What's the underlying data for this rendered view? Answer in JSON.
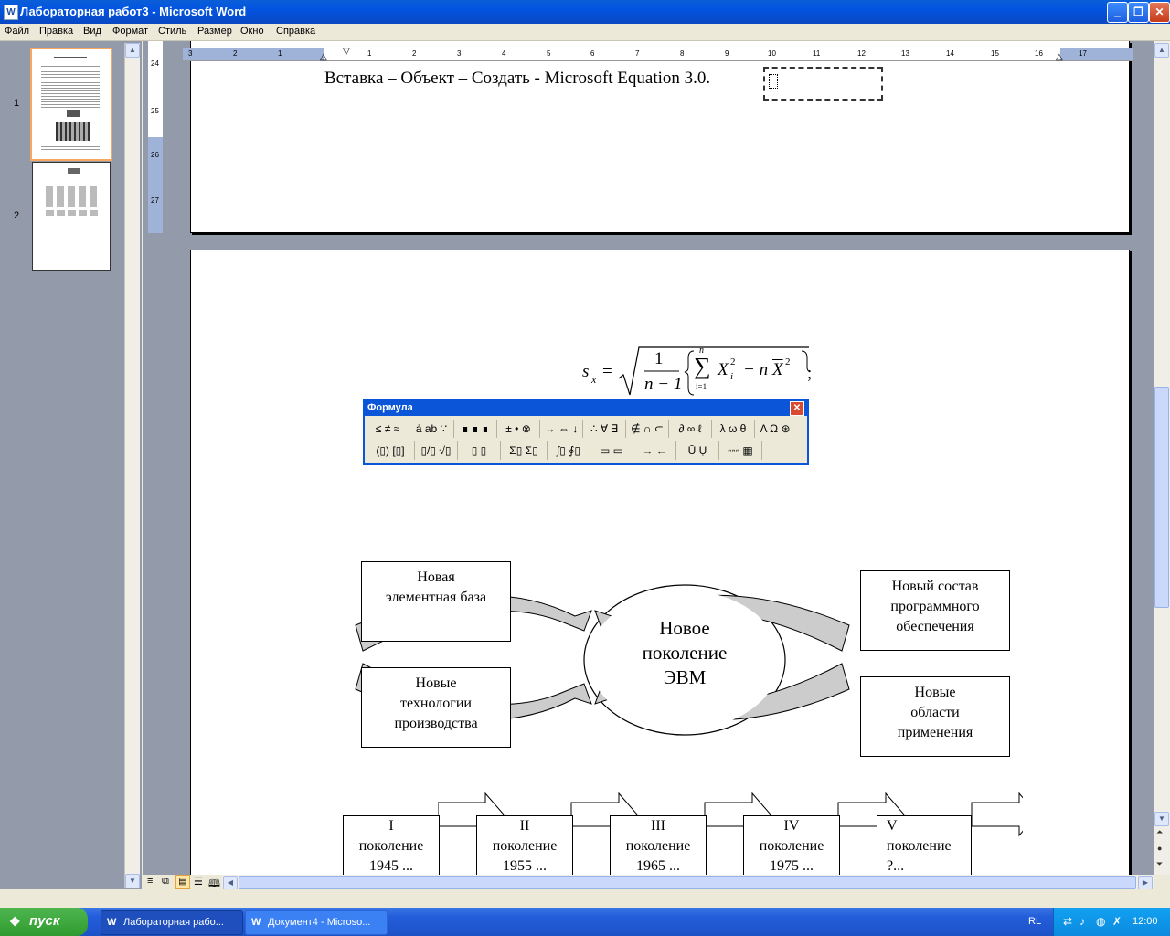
{
  "window": {
    "title": "Лабораторная работ3 - Microsoft Word",
    "app_icon": "W",
    "minimize_icon": "minimize-icon",
    "maximize_icon": "restore-icon",
    "close_icon": "close-icon"
  },
  "menu": {
    "items": [
      "Файл",
      "Правка",
      "Вид",
      "Формат",
      "Стиль",
      "Размер",
      "Окно",
      "Справка"
    ]
  },
  "thumbnails": [
    {
      "number": "1"
    },
    {
      "number": "2"
    }
  ],
  "ruler": {
    "h_labels": [
      "3",
      "2",
      "1",
      "1",
      "2",
      "3",
      "4",
      "5",
      "6",
      "7",
      "8",
      "9",
      "10",
      "11",
      "12",
      "13",
      "14",
      "15",
      "16",
      "17"
    ],
    "v_labels": [
      "24",
      "25",
      "26",
      "27"
    ]
  },
  "document": {
    "page1_text": "Вставка – Объект – Создать - Microsoft Equation 3.0.",
    "formula": {
      "lhs": "s",
      "lhs_sub": "x",
      "eq": "=",
      "num": "1",
      "den": "n − 1",
      "sum_top": "n",
      "sum_bottom": "i=1",
      "term1": "X",
      "term1_sub": "i",
      "term1_sup": "2",
      "minus": "− n",
      "term2": "X",
      "term2_sup": "2",
      "semicolon": ";"
    },
    "diagram": {
      "center": [
        "Новое",
        "поколение",
        "ЭВМ"
      ],
      "boxes": [
        [
          "Новая",
          "элементная база"
        ],
        [
          "Новые",
          "технологии",
          "производства"
        ],
        [
          "Новый состав",
          "программного",
          "обеспечения"
        ],
        [
          "Новые",
          "области",
          "применения"
        ]
      ],
      "generations": [
        [
          "I",
          "поколение",
          "1945 ..."
        ],
        [
          "II",
          "поколение",
          "1955 ..."
        ],
        [
          "III",
          "поколение",
          "1965 ..."
        ],
        [
          "IV",
          "поколение",
          "1975 ..."
        ],
        [
          "V",
          "поколение",
          "?..."
        ]
      ]
    }
  },
  "formula_toolbar": {
    "title": "Формула",
    "row1": [
      "≤ ≠ ≈",
      "ȧ ab ∵",
      "∎ ∎ ∎",
      "± • ⊗",
      "→ ⇔ ↓",
      "∴ ∀ ∃",
      "∉ ∩ ⊂",
      "∂ ∞ ℓ",
      "λ ω θ",
      "Λ Ω ⊛"
    ],
    "row2": [
      "(▯) [▯]",
      "▯/▯ √▯",
      "▯ ▯",
      "Σ▯ Σ▯",
      "∫▯ ∮▯",
      "▭ ▭",
      "→ ←",
      "Ū Ụ",
      "▫▫▫ ▦"
    ]
  },
  "taskbar": {
    "start": "пуск",
    "items": [
      "Лабораторная рабо...",
      "Документ4 - Microso..."
    ],
    "lang": "RL",
    "clock": "12:00"
  },
  "colors": {
    "title_blue": "#0a5fd8",
    "workspace_gray": "#939aa9",
    "thumb_selected": "#f5a85e",
    "start_green": "#3aa63a"
  }
}
